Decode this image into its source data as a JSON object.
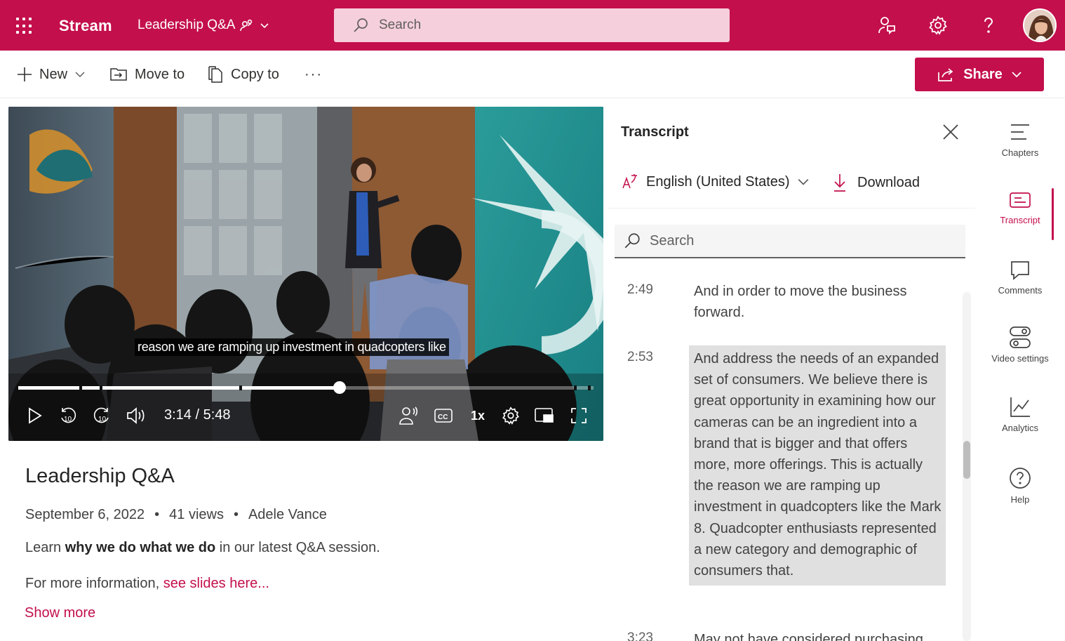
{
  "app": {
    "name": "Stream",
    "breadcrumb": "Leadership Q&A"
  },
  "header": {
    "search_placeholder": "Search"
  },
  "commands": {
    "new_label": "New",
    "move_label": "Move to",
    "copy_label": "Copy to",
    "more_label": "···",
    "share_label": "Share"
  },
  "player": {
    "caption": "reason we are ramping up investment in quadcopters like",
    "current_time": "3:14",
    "total_time": "5:48",
    "timecode": "3:14 / 5:48",
    "progress": 0.558,
    "chapter_marks": [
      0.106,
      0.141,
      0.384,
      0.966,
      0.99
    ],
    "speed": "1x",
    "watermark": "Leadership Q&A"
  },
  "video": {
    "title": "Leadership Q&A",
    "date": "September 6, 2022",
    "views": "41 views",
    "author": "Adele Vance",
    "desc_pre": "Learn ",
    "desc_bold": "why we do what we do",
    "desc_post": " in our latest Q&A session.",
    "more_pre": "For more information, ",
    "more_link": "see slides here...",
    "show_more": "Show more",
    "sep": "•"
  },
  "transcript": {
    "title": "Transcript",
    "language": "English (United States)",
    "download_label": "Download",
    "search_placeholder": "Search",
    "entries": [
      {
        "time": "2:49",
        "text": "And in order to move the business forward."
      },
      {
        "time": "2:53",
        "text": "And address the needs of an expanded set of consumers. We believe there is great opportunity in examining how our cameras can be an ingredient into a brand that is bigger and that offers more, more offerings. This is actually the reason we are ramping up investment in quadcopters like the Mark 8. Quadcopter enthusiasts represented a new category and demographic of consumers that."
      },
      {
        "time": "3:23",
        "text": "May not have considered purchasing"
      }
    ]
  },
  "rail": [
    {
      "label": "Chapters",
      "icon": "chapters-icon"
    },
    {
      "label": "Transcript",
      "icon": "transcript-icon"
    },
    {
      "label": "Comments",
      "icon": "comments-icon"
    },
    {
      "label": "Video settings",
      "icon": "video-settings-icon"
    },
    {
      "label": "Analytics",
      "icon": "analytics-icon"
    },
    {
      "label": "Help",
      "icon": "help-icon"
    }
  ],
  "colors": {
    "brand": "#c30f4b",
    "search_bg": "#f5cfdc",
    "active_segment": "#e0e0e0"
  }
}
